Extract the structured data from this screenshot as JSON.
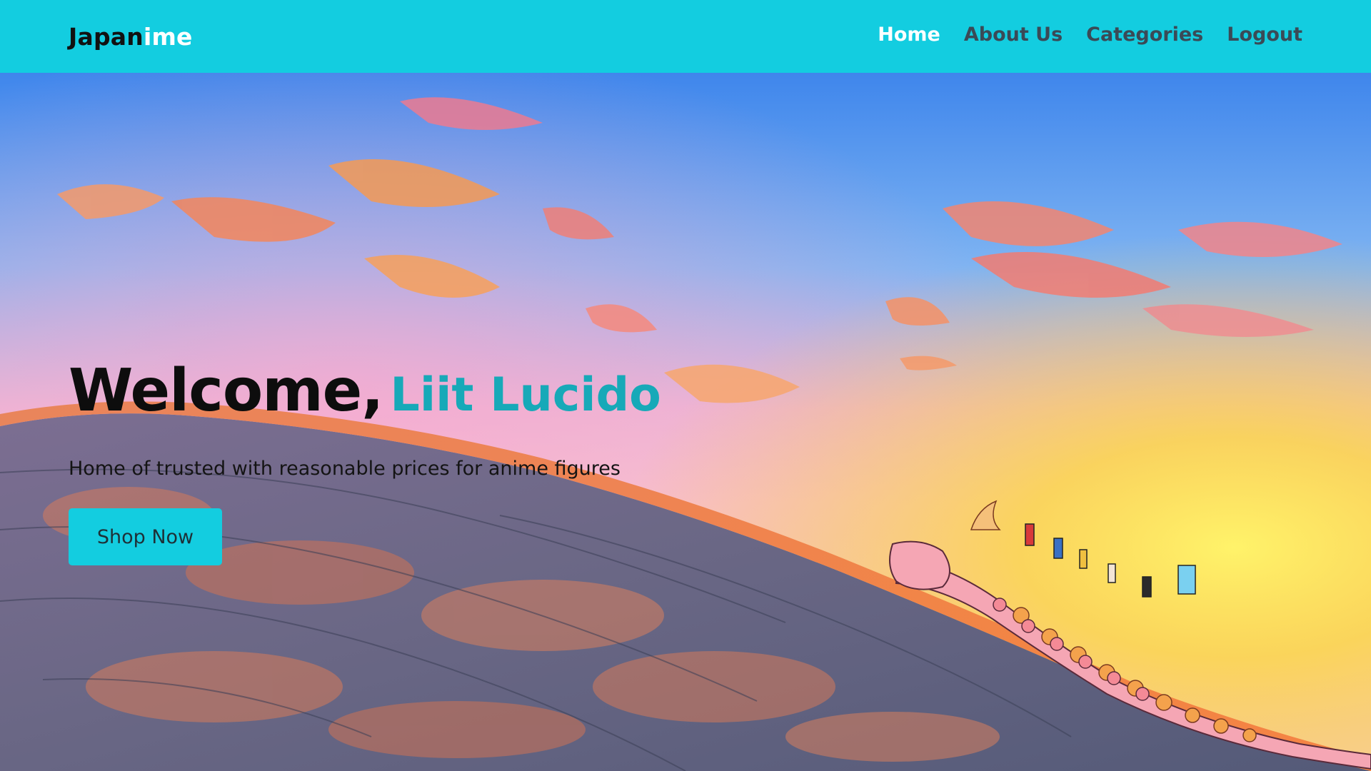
{
  "brand": {
    "part1": "Japan",
    "part2": "ime"
  },
  "nav": {
    "items": [
      {
        "label": "Home",
        "active": true
      },
      {
        "label": "About Us",
        "active": false
      },
      {
        "label": "Categories",
        "active": false
      },
      {
        "label": "Logout",
        "active": false
      }
    ]
  },
  "hero": {
    "welcome": "Welcome,",
    "user_name": "Liit Lucido",
    "tagline": "Home of trusted with reasonable prices for anime figures",
    "cta_label": "Shop Now"
  },
  "colors": {
    "accent": "#13cde0",
    "name_teal": "#17a9b8",
    "nav_text": "#3a4a56"
  }
}
